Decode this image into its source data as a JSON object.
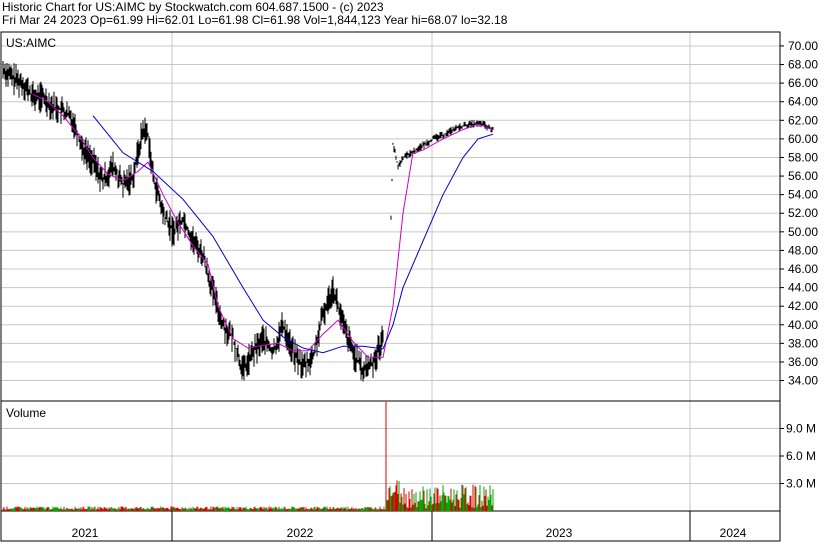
{
  "header": {
    "line1": "Historic Chart for US:AIMC by Stockwatch.com 604.687.1500 - (c) 2023",
    "line2": "Fri Mar 24 2023   Op=61.99  Hi=62.01  Lo=61.98  Cl=61.98  Vol=1,844,123   Year hi=68.07   lo=32.18"
  },
  "colors": {
    "price": "#000000",
    "ma_short": "#cc00cc",
    "ma_long": "#0000cc",
    "vol_up": "#00aa00",
    "vol_down": "#dd0000",
    "grid": "#c8c8c8",
    "border": "#000000"
  },
  "chart_data": [
    {
      "type": "line",
      "label": "US:AIMC",
      "y_ticks": [
        "70.00",
        "68.00",
        "66.00",
        "64.00",
        "62.00",
        "60.00",
        "58.00",
        "56.00",
        "54.00",
        "52.00",
        "50.00",
        "48.00",
        "46.00",
        "44.00",
        "42.00",
        "40.00",
        "38.00",
        "36.00",
        "34.00"
      ],
      "ylim": [
        31.8,
        71.5
      ],
      "x_ticks": [
        "2021",
        "2022",
        "2023",
        "2024"
      ],
      "grid": true,
      "series": [
        {
          "key": "price",
          "points": [
            [
              0,
              67.5
            ],
            [
              10,
              66.5
            ],
            [
              20,
              66
            ],
            [
              30,
              64.5
            ],
            [
              40,
              64.5
            ],
            [
              50,
              63.5
            ],
            [
              60,
              63
            ],
            [
              70,
              62
            ],
            [
              80,
              59
            ],
            [
              90,
              57.5
            ],
            [
              100,
              55.5
            ],
            [
              110,
              57
            ],
            [
              120,
              55
            ],
            [
              130,
              56
            ],
            [
              140,
              61
            ],
            [
              145,
              60.5
            ],
            [
              150,
              56
            ],
            [
              160,
              52
            ],
            [
              170,
              50
            ],
            [
              180,
              51.5
            ],
            [
              190,
              49
            ],
            [
              200,
              47.5
            ],
            [
              210,
              43.5
            ],
            [
              220,
              40
            ],
            [
              230,
              38.5
            ],
            [
              240,
              35
            ],
            [
              250,
              37
            ],
            [
              260,
              38.5
            ],
            [
              270,
              37
            ],
            [
              280,
              40
            ],
            [
              290,
              37
            ],
            [
              300,
              35.5
            ],
            [
              310,
              36.5
            ],
            [
              320,
              41
            ],
            [
              330,
              44
            ],
            [
              340,
              40
            ],
            [
              350,
              37
            ],
            [
              360,
              35
            ],
            [
              370,
              36
            ],
            [
              380,
              38.5
            ],
            [
              385,
              40
            ],
            [
              390,
              59.5
            ],
            [
              395,
              57
            ],
            [
              400,
              58
            ],
            [
              410,
              58.6
            ],
            [
              420,
              59.3
            ],
            [
              430,
              60
            ],
            [
              440,
              60.4
            ],
            [
              450,
              61
            ],
            [
              460,
              61.4
            ],
            [
              470,
              61.6
            ],
            [
              480,
              61.6
            ],
            [
              485,
              61.2
            ],
            [
              490,
              61
            ]
          ]
        },
        {
          "key": "ma_short",
          "points": [
            [
              30,
              64.8
            ],
            [
              45,
              64
            ],
            [
              60,
              62.5
            ],
            [
              75,
              60.5
            ],
            [
              90,
              58
            ],
            [
              105,
              56.2
            ],
            [
              120,
              55.5
            ],
            [
              135,
              56.5
            ],
            [
              145,
              57.5
            ],
            [
              160,
              54
            ],
            [
              175,
              51
            ],
            [
              190,
              48.5
            ],
            [
              205,
              46.5
            ],
            [
              215,
              42
            ],
            [
              230,
              38.5
            ],
            [
              245,
              37.5
            ],
            [
              260,
              37.8
            ],
            [
              275,
              38
            ],
            [
              290,
              37.2
            ],
            [
              305,
              37.2
            ],
            [
              320,
              39
            ],
            [
              335,
              40.5
            ],
            [
              350,
              38.2
            ],
            [
              365,
              36.5
            ],
            [
              380,
              36.5
            ],
            [
              390,
              42
            ],
            [
              400,
              52
            ],
            [
              410,
              58.5
            ],
            [
              420,
              58.8
            ],
            [
              440,
              60
            ],
            [
              460,
              61
            ],
            [
              475,
              61.6
            ],
            [
              490,
              61
            ]
          ]
        },
        {
          "key": "ma_long",
          "points": [
            [
              90,
              62.5
            ],
            [
              120,
              58.5
            ],
            [
              150,
              56.5
            ],
            [
              180,
              53.5
            ],
            [
              210,
              49.5
            ],
            [
              240,
              44
            ],
            [
              260,
              40.5
            ],
            [
              280,
              38.7
            ],
            [
              300,
              37.5
            ],
            [
              320,
              37
            ],
            [
              340,
              37.7
            ],
            [
              360,
              37.7
            ],
            [
              380,
              37.4
            ],
            [
              390,
              40
            ],
            [
              400,
              44
            ],
            [
              420,
              49
            ],
            [
              440,
              54
            ],
            [
              460,
              58
            ],
            [
              475,
              60
            ],
            [
              490,
              60.5
            ]
          ]
        }
      ]
    },
    {
      "type": "bar",
      "label": "Volume",
      "y_ticks": [
        "9.0 M",
        "6.0 M",
        "3.0 M"
      ],
      "ylim": [
        0,
        12.0
      ],
      "grid": true
    }
  ]
}
